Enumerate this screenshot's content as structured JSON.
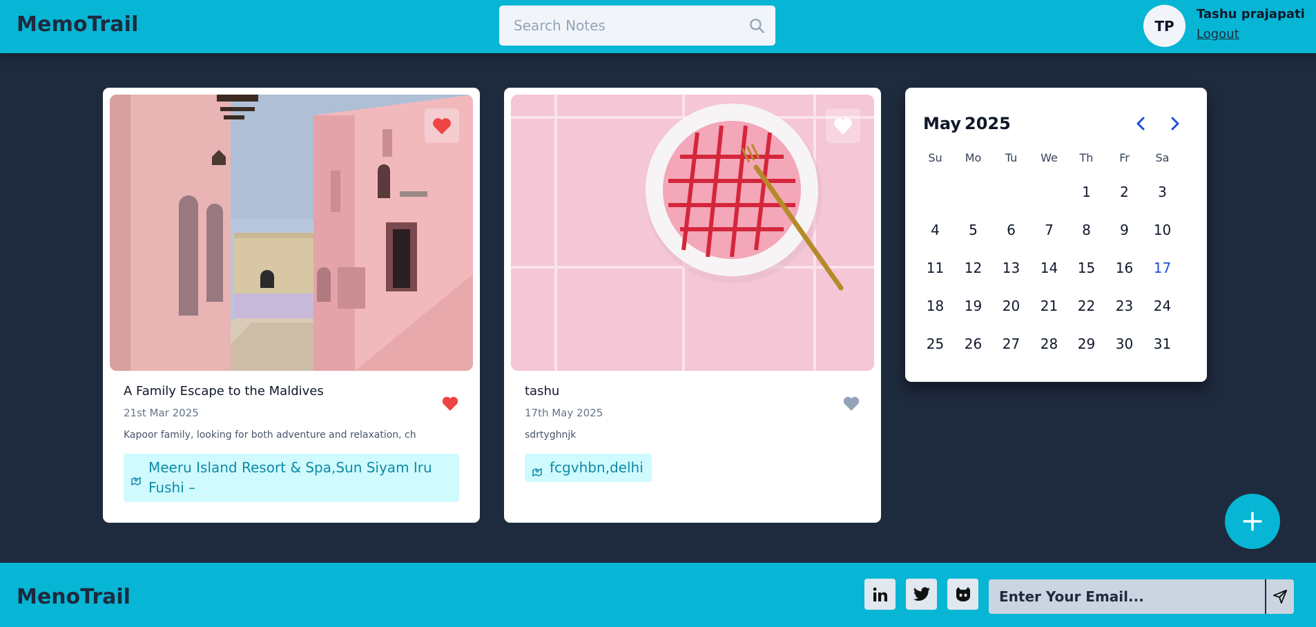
{
  "header": {
    "brand": "MemoTrail",
    "search_placeholder": "Search Notes",
    "user": {
      "initials": "TP",
      "name": "Tashu prajapati",
      "logout_label": "Logout"
    }
  },
  "cards": [
    {
      "title": "A Family Escape to the Maldives",
      "date": "21st Mar 2025",
      "description": "Kapoor family, looking for both adventure and relaxation, ch",
      "location": "Meeru Island Resort & Spa,Sun Siyam Iru Fushi –",
      "favorite": true,
      "image": "pink-buildings-photo"
    },
    {
      "title": "tashu",
      "date": "17th May 2025",
      "description": "sdrtyghnjk",
      "location": "fcgvhbn,delhi",
      "favorite": false,
      "image": "pink-plate-photo"
    }
  ],
  "calendar": {
    "month": "May",
    "year": "2025",
    "weekdays": [
      "Su",
      "Mo",
      "Tu",
      "We",
      "Th",
      "Fr",
      "Sa"
    ],
    "first_weekday_index": 4,
    "days_in_month": 31,
    "selected_day": 17
  },
  "add_button_icon": "plus-icon",
  "footer": {
    "brand": "MenoTrail",
    "social": [
      "linkedin-icon",
      "twitter-icon",
      "github-icon"
    ],
    "email_placeholder": "Enter Your Email..."
  },
  "colors": {
    "primary": "#06b6d4",
    "background": "#1e2a3e",
    "favorite": "#ef4444",
    "today": "#1d4ed8"
  }
}
